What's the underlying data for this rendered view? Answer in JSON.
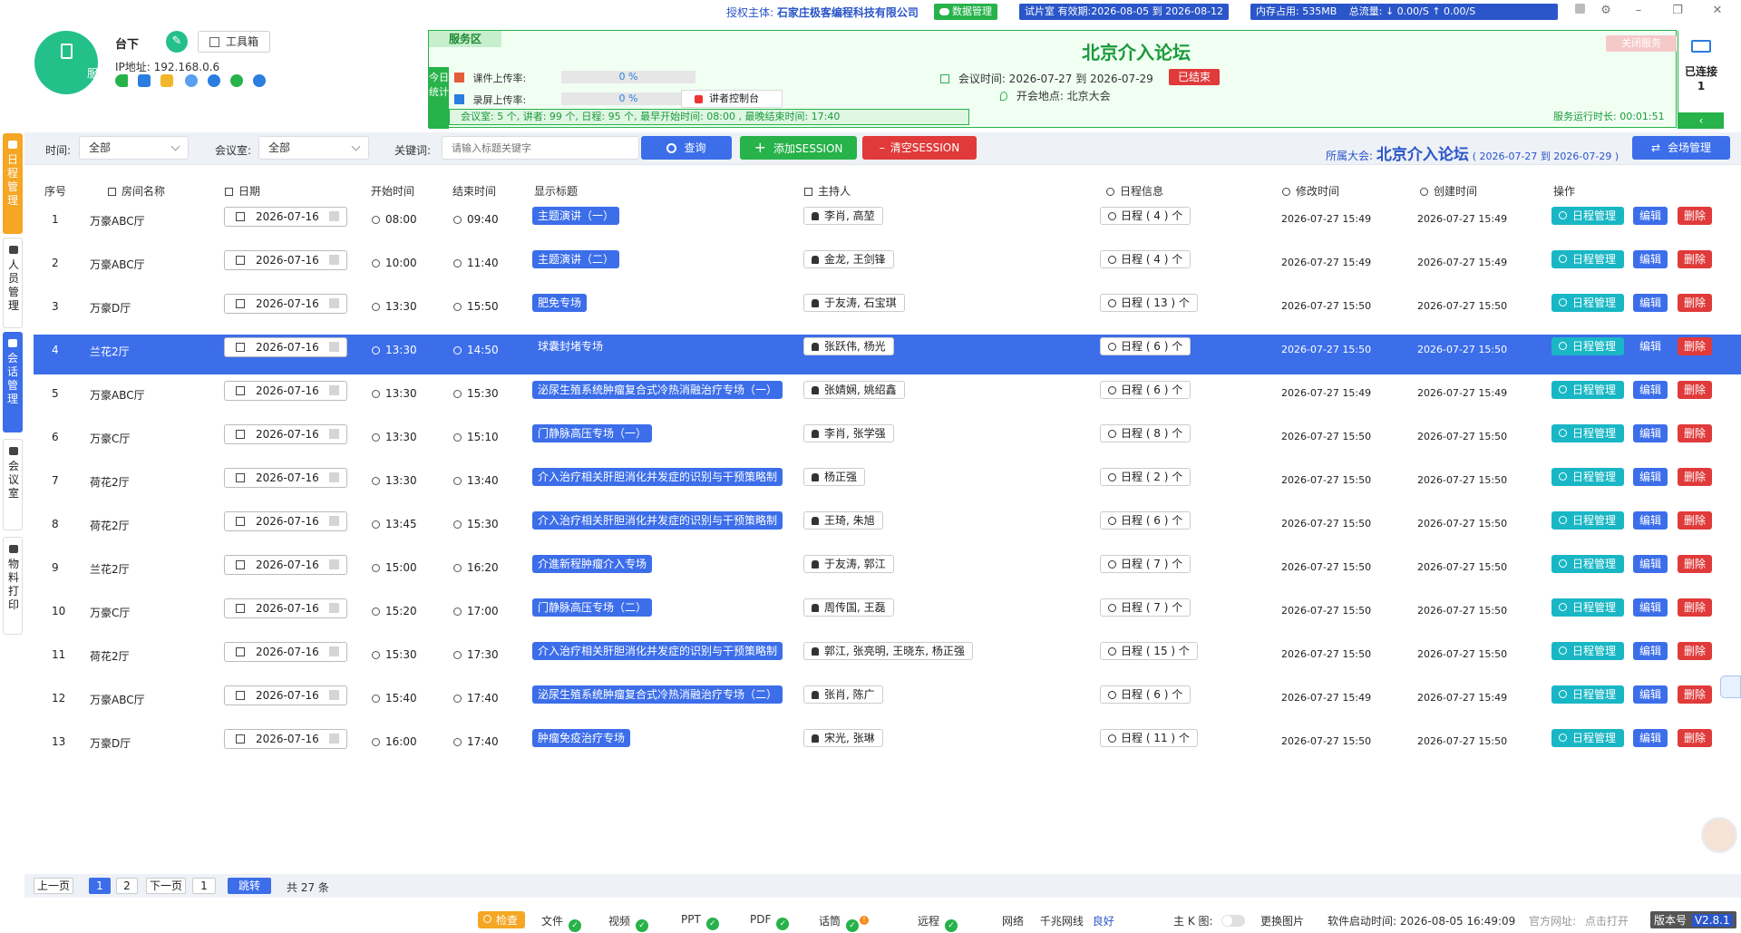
{
  "topbar": {
    "auth_label": "授权主体:",
    "auth_value": "石家庄极客编程科技有限公司",
    "data_mgmt": "数据管理",
    "trial": "试片室 有效期:2026-08-05 到 2026-08-12",
    "memory": "内存占用:  535MB",
    "traffic": "总流量:  ↓ 0.00/S    ↑ 0.00/S",
    "help_icon": "help-icon",
    "settings_icon": "gear-icon",
    "colors": {
      "green": "#27b24a",
      "blue": "#2a55c9"
    }
  },
  "header": {
    "avatar_label": "服务",
    "room_name": "台下",
    "toolbox_label": "工具箱",
    "ip": "IP地址: 192.168.0.6"
  },
  "service": {
    "tag": "服务区",
    "today_stats": "今日统计",
    "title": "北京介入论坛",
    "close_label": "关闭服务",
    "courseware_label": "课件上传率:",
    "courseware_pct": "0 %",
    "recording_label": "录屏上传率:",
    "recording_pct": "0 %",
    "speaker_console": "讲者控制台",
    "meeting_time": "会议时间:    2026-07-27   到   2026-07-29",
    "ended": "已结束",
    "venue": "开会地点:    北京大会",
    "stats": "会议室:  5 个,  讲者:  99 个,  日程:  95 个,  最早开始时间:  08:00 ,    最晚结束时间:  17:40",
    "runtime": "服务运行时长: 00:01:51",
    "conn_title": "已连接",
    "conn_count": "1"
  },
  "leftnav": [
    {
      "label": "日程管理",
      "active": true
    },
    {
      "label": "人员管理",
      "active": false
    },
    {
      "label": "会话管理",
      "active": false
    },
    {
      "label": "会议室",
      "active": false
    },
    {
      "label": "物料打印",
      "active": false
    }
  ],
  "filters": {
    "time_label": "时间:",
    "time_value": "全部",
    "room_label": "会议室:",
    "room_value": "全部",
    "keyword_label": "关键词:",
    "keyword_placeholder": "请输入标题关键字",
    "search": "查询",
    "add": "添加SESSION",
    "clear": "清空SESSION",
    "belongs_label": "所属大会:",
    "belongs_name": "北京介入论坛",
    "belongs_dates": "( 2026-07-27 到 2026-07-29 )",
    "venue_mgmt": "会场管理"
  },
  "table": {
    "headers": [
      "序号",
      "房间名称",
      "日期",
      "开始时间",
      "结束时间",
      "显示标题",
      "主持人",
      "日程信息",
      "修改时间",
      "创建时间",
      "操作"
    ],
    "op_manage": "日程管理",
    "op_edit": "编辑",
    "op_delete": "删除",
    "rows": [
      {
        "no": "1",
        "room": "万豪ABC厅",
        "date": "2026-07-16",
        "start": "08:00",
        "end": "09:40",
        "title": "主题演讲（一）",
        "host": "李肖, 高堃",
        "sched": "日程 ( 4 ) 个",
        "modified": "2026-07-27 15:49",
        "created": "2026-07-27 15:49"
      },
      {
        "no": "2",
        "room": "万豪ABC厅",
        "date": "2026-07-16",
        "start": "10:00",
        "end": "11:40",
        "title": "主题演讲（二）",
        "host": "金龙, 王剑锋",
        "sched": "日程 ( 4 ) 个",
        "modified": "2026-07-27 15:49",
        "created": "2026-07-27 15:49"
      },
      {
        "no": "3",
        "room": "万豪D厅",
        "date": "2026-07-16",
        "start": "13:30",
        "end": "15:50",
        "title": "肥免专场",
        "host": "于友涛, 石宝琪",
        "sched": "日程 ( 13 ) 个",
        "modified": "2026-07-27 15:50",
        "created": "2026-07-27 15:50"
      },
      {
        "no": "4",
        "room": "兰花2厅",
        "date": "2026-07-16",
        "start": "13:30",
        "end": "14:50",
        "title": "球囊封堵专场",
        "host": "张跃伟, 杨光",
        "sched": "日程 ( 6 ) 个",
        "modified": "2026-07-27 15:50",
        "created": "2026-07-27 15:50"
      },
      {
        "no": "5",
        "room": "万豪ABC厅",
        "date": "2026-07-16",
        "start": "13:30",
        "end": "15:30",
        "title": "泌尿生殖系统肿瘤复合式冷热消融治疗专场（一）",
        "host": "张婧娴, 姚绍鑫",
        "sched": "日程 ( 6 ) 个",
        "modified": "2026-07-27 15:49",
        "created": "2026-07-27 15:49"
      },
      {
        "no": "6",
        "room": "万豪C厅",
        "date": "2026-07-16",
        "start": "13:30",
        "end": "15:10",
        "title": "门静脉高压专场（一）",
        "host": "李肖, 张学强",
        "sched": "日程 ( 8 ) 个",
        "modified": "2026-07-27 15:50",
        "created": "2026-07-27 15:50"
      },
      {
        "no": "7",
        "room": "荷花2厅",
        "date": "2026-07-16",
        "start": "13:30",
        "end": "13:40",
        "title": "介入治疗相关肝胆消化并发症的识别与干预策略制",
        "host": "杨正强",
        "sched": "日程 ( 2 ) 个",
        "modified": "2026-07-27 15:50",
        "created": "2026-07-27 15:50"
      },
      {
        "no": "8",
        "room": "荷花2厅",
        "date": "2026-07-16",
        "start": "13:45",
        "end": "15:30",
        "title": "介入治疗相关肝胆消化并发症的识别与干预策略制",
        "host": "王琦, 朱旭",
        "sched": "日程 ( 6 ) 个",
        "modified": "2026-07-27 15:50",
        "created": "2026-07-27 15:50"
      },
      {
        "no": "9",
        "room": "兰花2厅",
        "date": "2026-07-16",
        "start": "15:00",
        "end": "16:20",
        "title": "介進新程肿瘤介入专场",
        "host": "于友涛, 郭江",
        "sched": "日程 ( 7 ) 个",
        "modified": "2026-07-27 15:50",
        "created": "2026-07-27 15:50"
      },
      {
        "no": "10",
        "room": "万豪C厅",
        "date": "2026-07-16",
        "start": "15:20",
        "end": "17:00",
        "title": "门静脉高压专场（二）",
        "host": "周传国, 王磊",
        "sched": "日程 ( 7 ) 个",
        "modified": "2026-07-27 15:50",
        "created": "2026-07-27 15:50"
      },
      {
        "no": "11",
        "room": "荷花2厅",
        "date": "2026-07-16",
        "start": "15:30",
        "end": "17:30",
        "title": "介入治疗相关肝胆消化并发症的识别与干预策略制",
        "host": "郭江, 张亮明, 王晓东, 杨正强",
        "sched": "日程 ( 15 ) 个",
        "modified": "2026-07-27 15:50",
        "created": "2026-07-27 15:50"
      },
      {
        "no": "12",
        "room": "万豪ABC厅",
        "date": "2026-07-16",
        "start": "15:40",
        "end": "17:40",
        "title": "泌尿生殖系统肿瘤复合式冷热消融治疗专场（二）",
        "host": "张肖, 陈广",
        "sched": "日程 ( 6 ) 个",
        "modified": "2026-07-27 15:49",
        "created": "2026-07-27 15:49"
      },
      {
        "no": "13",
        "room": "万豪D厅",
        "date": "2026-07-16",
        "start": "16:00",
        "end": "17:40",
        "title": "肿瘤免疫治疗专场",
        "host": "宋光, 张琳",
        "sched": "日程 ( 11 ) 个",
        "modified": "2026-07-27 15:50",
        "created": "2026-07-27 15:50"
      }
    ],
    "selected_row": 4
  },
  "pager": {
    "prev": "上一页",
    "p1": "1",
    "p2": "2",
    "next": "下一页",
    "jump_value": "1",
    "jump": "跳转",
    "total": "共 27 条"
  },
  "status": {
    "check": "检查",
    "file": "文件",
    "video": "视频",
    "ppt": "PPT",
    "pdf": "PDF",
    "mic": "话筒",
    "remote": "远程",
    "network": "网络",
    "net_type": "千兆网线",
    "net_quality": "良好",
    "main_k": "主 K 图:",
    "change_pic": "更换图片",
    "start_time": "软件启动时间:  2026-08-05 16:49:09",
    "official_label": "官方网址:",
    "official_link": "点击打开",
    "version_label": "版本号",
    "version": "V2.8.1"
  }
}
